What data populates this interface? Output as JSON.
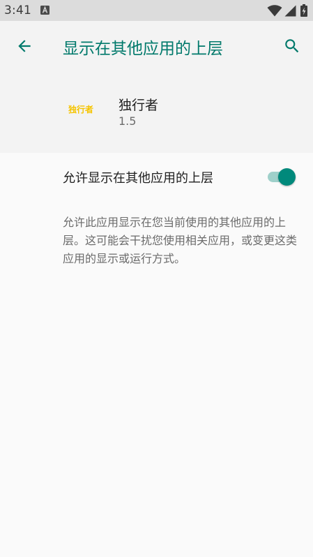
{
  "status_bar": {
    "time": "3:41",
    "notification_icon": "accessibility-a-icon",
    "wifi_icon": "wifi-icon",
    "signal_icon": "cell-signal-icon",
    "battery_icon": "battery-charging-icon"
  },
  "app_bar": {
    "back_icon": "arrow-back-icon",
    "title": "显示在其他应用的上层",
    "search_icon": "search-icon"
  },
  "app_header": {
    "logo_text": "独行者",
    "name": "独行者",
    "version": "1.5"
  },
  "permission": {
    "label": "允许显示在其他应用的上层",
    "enabled": true
  },
  "description": "允许此应用显示在您当前使用的其他应用的上层。这可能会干扰您使用相关应用，或变更这类应用的显示或运行方式。",
  "colors": {
    "accent": "#00796b",
    "toggle_thumb": "#00897b",
    "toggle_track": "#9fd0ca",
    "logo": "#f5c400"
  }
}
